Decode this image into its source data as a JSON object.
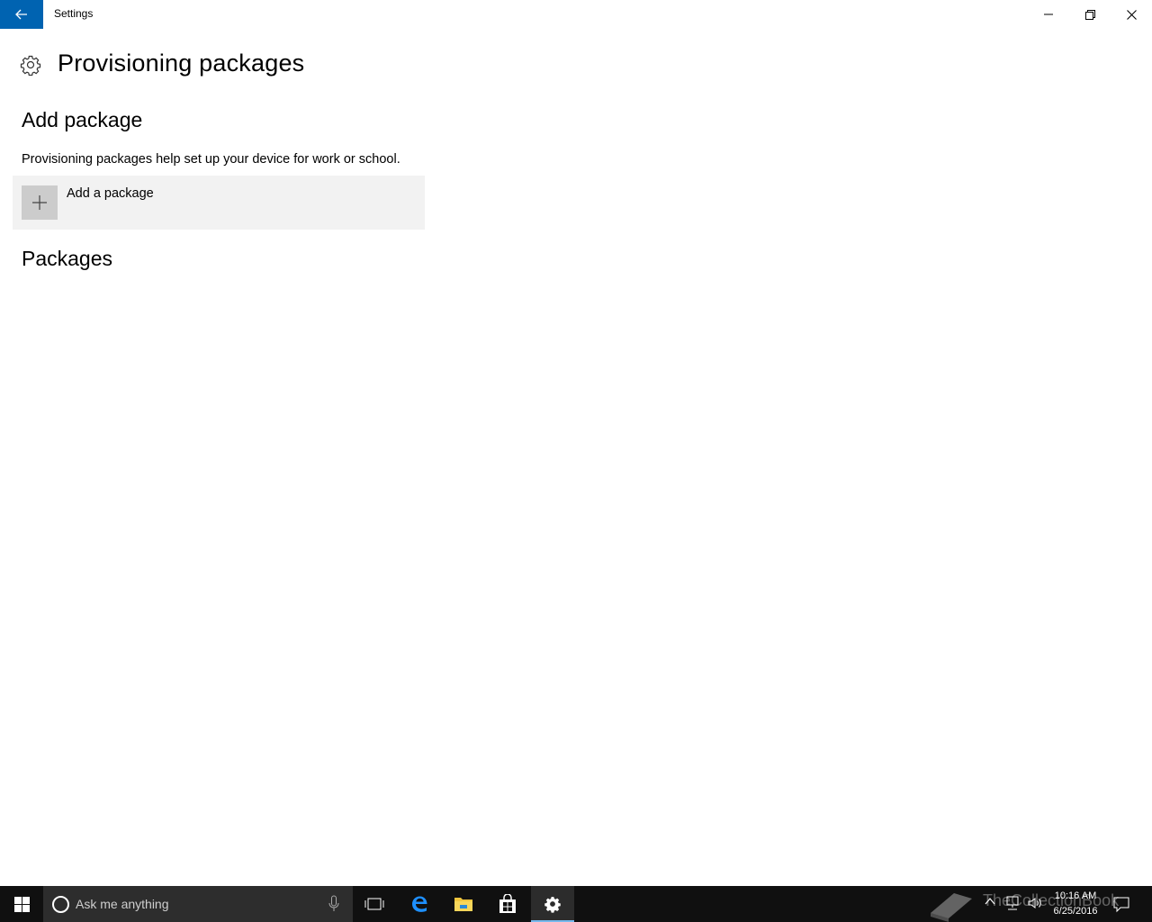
{
  "window": {
    "title": "Settings"
  },
  "header": {
    "title": "Provisioning packages"
  },
  "add_section": {
    "heading": "Add package",
    "description": "Provisioning packages help set up your device for work or school.",
    "add_button_label": "Add a package"
  },
  "packages_section": {
    "heading": "Packages"
  },
  "taskbar": {
    "search_placeholder": "Ask me anything",
    "watermark_text": "TheCollectionBook",
    "clock_time": "10:16 AM",
    "clock_date": "6/25/2016"
  },
  "colors": {
    "accent": "#0063b1",
    "taskbar": "#101010",
    "tile_bg": "#f2f2f2"
  },
  "icons": [
    "back-arrow-icon",
    "minimize-icon",
    "restore-icon",
    "close-icon",
    "gear-icon",
    "plus-icon",
    "windows-logo-icon",
    "cortana-icon",
    "microphone-icon",
    "task-view-icon",
    "edge-icon",
    "file-explorer-icon",
    "store-icon",
    "settings-gear-icon",
    "book-icon",
    "chevron-up-icon",
    "network-icon",
    "volume-icon",
    "action-center-icon"
  ]
}
